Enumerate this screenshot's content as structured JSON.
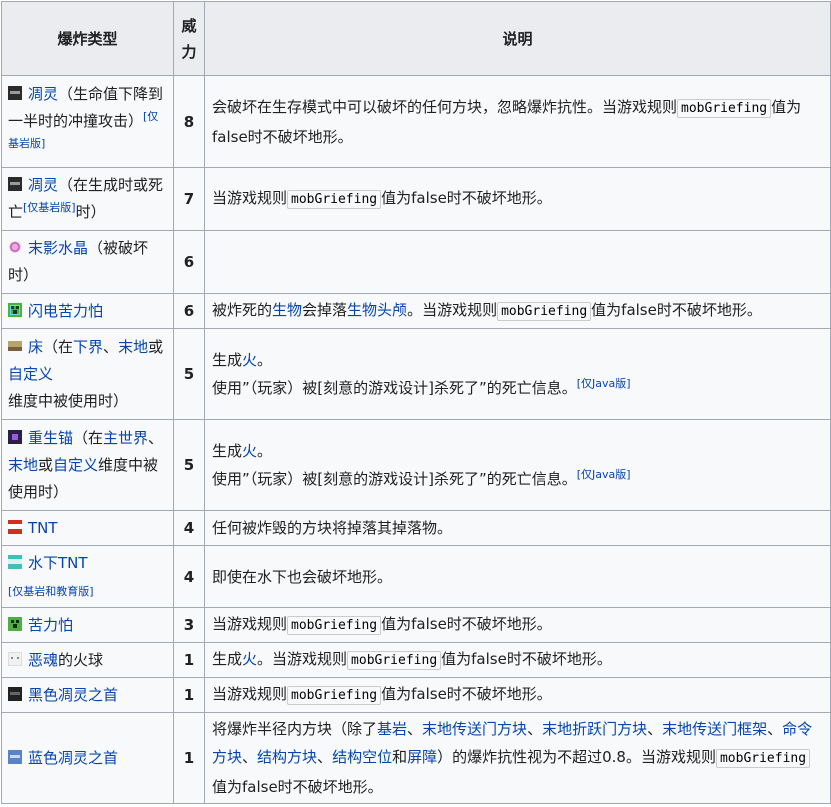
{
  "header": {
    "type": "爆炸类型",
    "power": "威力",
    "desc": "说明"
  },
  "rows": {
    "r1": {
      "name": "凋灵",
      "rest": "（生命值下降到一半时的冲撞攻击）",
      "note": "[仅基岩版]",
      "power": "8",
      "desc_a": "会破坏在生存模式中可以破坏的任何方块，忽略爆炸抗性。当游戏规则",
      "code": "mobGriefing",
      "desc_b": "值为false时不破坏地形。",
      "icon": "wither-icon"
    },
    "r2": {
      "name": "凋灵",
      "rest_a": "（在生成时或死亡",
      "note": "[仅基岩版]",
      "rest_b": "时）",
      "power": "7",
      "desc_a": "当游戏规则",
      "code": "mobGriefing",
      "desc_b": "值为false时不破坏地形。",
      "icon": "wither-icon"
    },
    "r3": {
      "name": "末影水晶",
      "rest": "（被破坏时）",
      "power": "6",
      "icon": "end-crystal-icon"
    },
    "r4": {
      "name": "闪电苦力怕",
      "power": "6",
      "d1": "被炸死的",
      "d2": "生物",
      "d3": "会掉落",
      "d4": "生物头颅",
      "d5": "。当游戏规则",
      "code": "mobGriefing",
      "d6": "值为false时不破坏地形。",
      "icon": "charged-creeper-icon"
    },
    "r5": {
      "name": "床",
      "t1": "（在",
      "t2": "下界",
      "t3": "、",
      "t4": "末地",
      "t5": "或",
      "t6": "自定义",
      "t7": "维度中被使用时）",
      "power": "5",
      "l1a": "生成",
      "l1b": "火",
      "l1c": "。",
      "l2": "使用”（玩家）被[刻意的游戏设计]杀死了”的死亡信息。",
      "note": "[仅Java版]",
      "icon": "bed-icon"
    },
    "r6": {
      "name": "重生锚",
      "t1": "（在",
      "t2": "主世界",
      "t3": "、",
      "t4": "末地",
      "t5": "或",
      "t6": "自定义",
      "t7": "维度中被使用时）",
      "power": "5",
      "l1a": "生成",
      "l1b": "火",
      "l1c": "。",
      "l2": "使用”（玩家）被[刻意的游戏设计]杀死了”的死亡信息。",
      "note": "[仅Java版]",
      "icon": "respawn-anchor-icon"
    },
    "r7": {
      "name": "TNT",
      "power": "4",
      "desc": "任何被炸毁的方块将掉落其掉落物。",
      "icon": "tnt-icon"
    },
    "r8": {
      "name": "水下TNT",
      "note": "[仅基岩和教育版]",
      "power": "4",
      "desc": "即使在水下也会破坏地形。",
      "icon": "underwater-tnt-icon"
    },
    "r9": {
      "name": "苦力怕",
      "power": "3",
      "desc_a": "当游戏规则",
      "code": "mobGriefing",
      "desc_b": "值为false时不破坏地形。",
      "icon": "creeper-icon"
    },
    "r10": {
      "name": "恶魂",
      "rest": "的火球",
      "power": "1",
      "d1": "生成",
      "d2": "火",
      "d3": "。当游戏规则",
      "code": "mobGriefing",
      "d4": "值为false时不破坏地形。",
      "icon": "ghast-icon"
    },
    "r11": {
      "name": "黑色凋灵之首",
      "power": "1",
      "desc_a": "当游戏规则",
      "code": "mobGriefing",
      "desc_b": "值为false时不破坏地形。",
      "icon": "black-wither-skull-icon"
    },
    "r12": {
      "name": "蓝色凋灵之首",
      "power": "1",
      "p1": "将爆炸半径内方块（除了",
      "k1": "基岩",
      "s1": "、",
      "k2": "末地传送门方块",
      "s2": "、",
      "k3": "末地折跃门方块",
      "s3": "、",
      "k4": "末地传送门框架",
      "s4": "、",
      "k5": "命令方块",
      "s5": "、",
      "k6": "结构方块",
      "s6": "、",
      "k7": "结构空位",
      "s7": "和",
      "k8": "屏障",
      "p2": "）的爆炸抗性视为不超过0.8。当游戏规则",
      "code": "mobGriefing",
      "p3": "值为false时不破坏地形。",
      "icon": "blue-wither-skull-icon"
    }
  }
}
